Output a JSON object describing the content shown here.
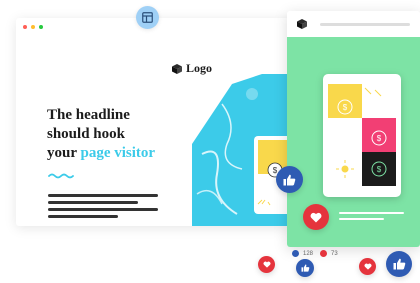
{
  "landing": {
    "logo_text": "Logo",
    "headline_line1": "The headline",
    "headline_line2": "should hook",
    "headline_line3_prefix": "your ",
    "headline_line3_accent": "page visitor"
  },
  "social": {
    "likes_count": "128",
    "hearts_count": "73"
  },
  "colors": {
    "accent_cyan": "#3ccbe9",
    "heart_red": "#e5343d",
    "like_blue": "#2f5bb3",
    "green_bg": "#7de3a5",
    "dot_red": "#ff5f56",
    "dot_yellow": "#ffbd2e",
    "dot_green": "#27c93f"
  },
  "icons": [
    "layout-icon",
    "logo-cube-icon",
    "heart-icon",
    "thumbs-up-icon",
    "dollar-coin-icon",
    "sun-icon"
  ]
}
